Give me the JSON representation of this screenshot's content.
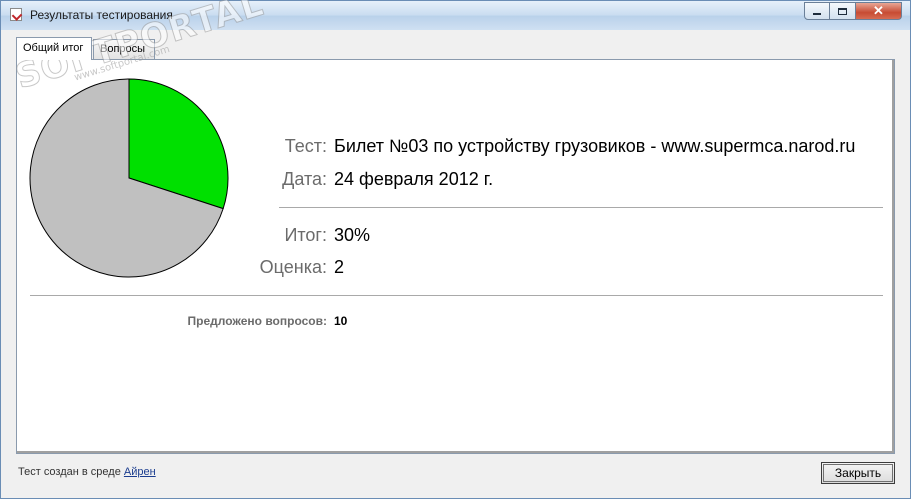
{
  "window": {
    "title": "Результаты тестирования",
    "caption_buttons": {
      "minimize": "minimize-icon",
      "maximize": "maximize-icon",
      "close": "✕"
    }
  },
  "tabs": [
    {
      "label": "Общий итог",
      "active": true
    },
    {
      "label": "Вопросы",
      "active": false
    }
  ],
  "summary": {
    "test_label": "Тест:",
    "test_value": "Билет №03 по устройству грузовиков - www.supermca.narod.ru",
    "date_label": "Дата:",
    "date_value": "24 февраля 2012 г.",
    "result_label": "Итог:",
    "result_value": "30%",
    "grade_label": "Оценка:",
    "grade_value": "2",
    "questions_label": "Предложено вопросов:",
    "questions_value": "10"
  },
  "chart_data": {
    "type": "pie",
    "values": [
      30,
      70
    ],
    "colors": [
      "#00e000",
      "#c0c0c0"
    ]
  },
  "watermark": {
    "text": "SOFTPORTAL",
    "sub": "www.softportal.com"
  },
  "footer": {
    "created_prefix": "Тест создан в среде ",
    "created_link": "Айрен",
    "close_button": "Закрыть"
  }
}
